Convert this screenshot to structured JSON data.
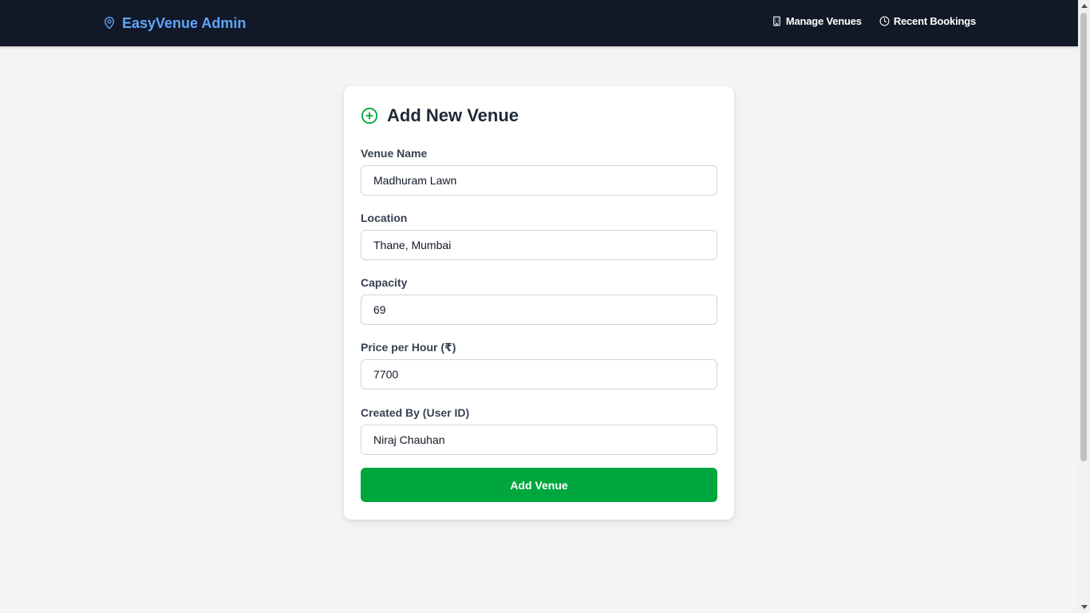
{
  "navbar": {
    "brand": "EasyVenue Admin",
    "links": [
      {
        "label": "Manage Venues",
        "icon": "building-icon"
      },
      {
        "label": "Recent Bookings",
        "icon": "clock-icon"
      }
    ]
  },
  "form": {
    "title": "Add New Venue",
    "fields": [
      {
        "label": "Venue Name",
        "value": "Madhuram Lawn"
      },
      {
        "label": "Location",
        "value": "Thane, Mumbai"
      },
      {
        "label": "Capacity",
        "value": "69"
      },
      {
        "label": "Price per Hour (₹)",
        "value": "7700"
      },
      {
        "label": "Created By (User ID)",
        "value": "Niraj Chauhan"
      }
    ],
    "submit_label": "Add Venue"
  },
  "colors": {
    "nav_bg": "#111827",
    "brand": "#60a5fa",
    "accent_green": "#00a63e",
    "page_bg": "#f3f4f6"
  }
}
